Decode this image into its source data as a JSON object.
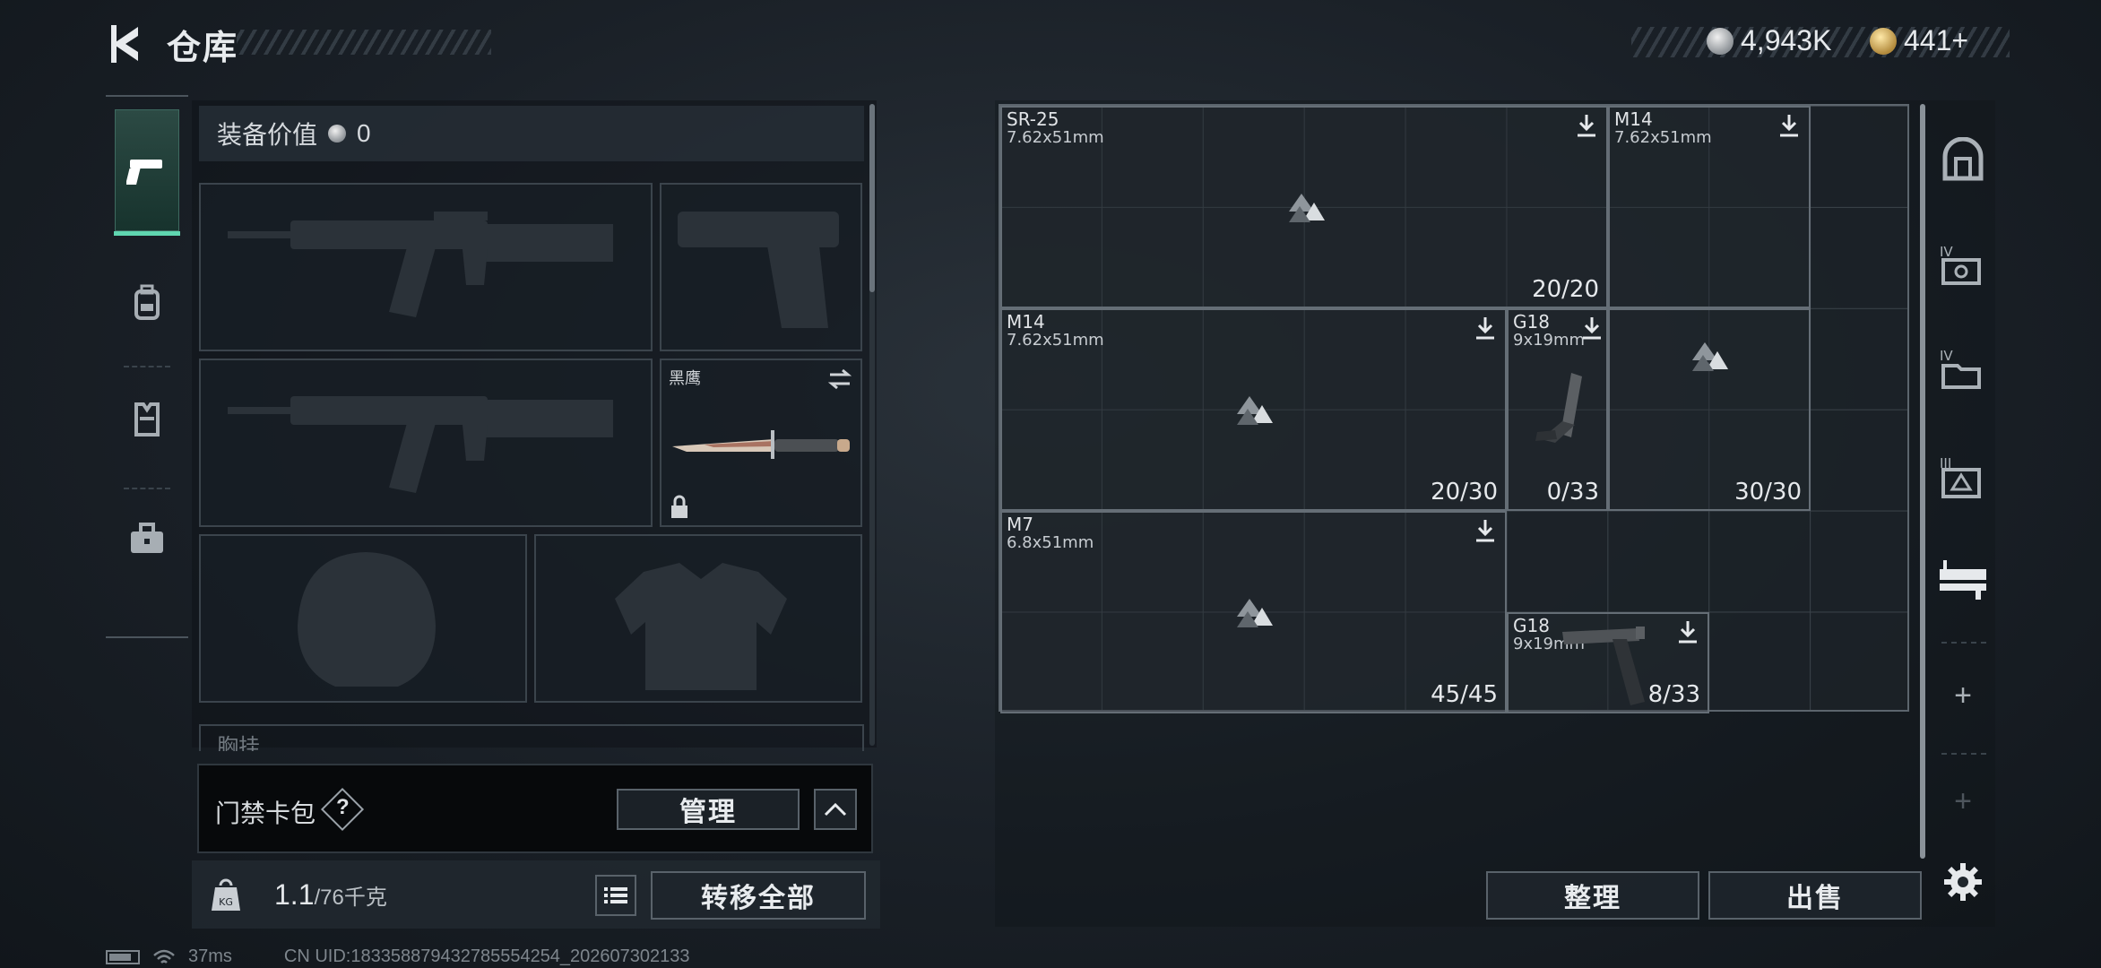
{
  "header": {
    "title": "仓库",
    "currency_silver": "4,943K",
    "currency_gold": "441+"
  },
  "loadout": {
    "equip_value_label": "装备价值",
    "equip_value": "0",
    "knife_label": "黑鹰",
    "chest_label": "胸挂",
    "chest_hint": "?"
  },
  "keycard": {
    "label": "门禁卡包",
    "help": "?",
    "manage_label": "管理"
  },
  "footer_left": {
    "weight_current": "1.1",
    "weight_max": "/76千克",
    "transfer_all_label": "转移全部"
  },
  "stash": {
    "items": [
      {
        "name": "SR-25",
        "caliber": "7.62x51mm",
        "ammo": "20/20"
      },
      {
        "name": "M14",
        "caliber": "7.62x51mm",
        "ammo": ""
      },
      {
        "name": "M14",
        "caliber": "7.62x51mm",
        "ammo": "20/30"
      },
      {
        "name": "G18",
        "caliber": "9x19mm",
        "ammo": "0/33"
      },
      {
        "name": "M7",
        "caliber": "6.8x51mm",
        "ammo": "45/45"
      },
      {
        "name": "G18",
        "caliber": "9x19mm",
        "ammo": "8/33"
      },
      {
        "name": "",
        "caliber": "",
        "ammo": "30/30"
      }
    ],
    "sort_label": "整理",
    "sell_label": "出售"
  },
  "side_nav": {
    "add_label": "+",
    "add2_label": "+"
  },
  "status": {
    "ping": "37ms",
    "uid": "CN UID:18335887943278555425​4_202607302133"
  }
}
